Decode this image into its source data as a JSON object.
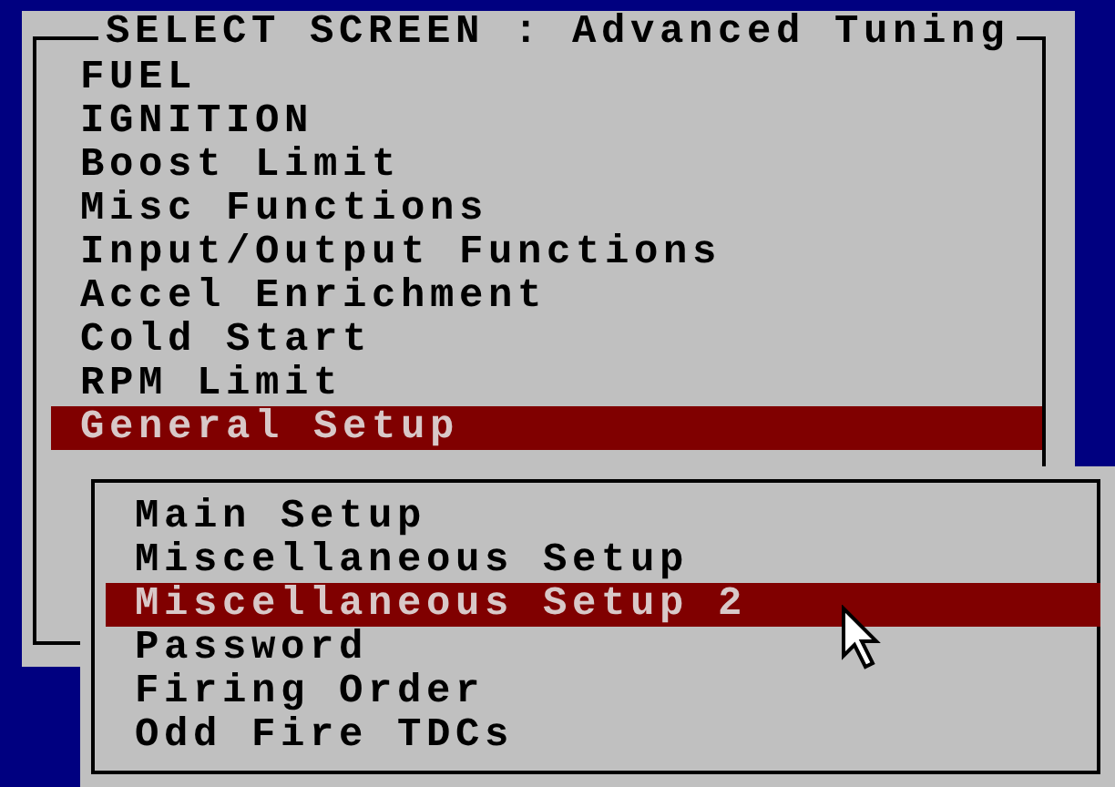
{
  "dialog": {
    "title": "SELECT SCREEN : Advanced Tuning",
    "items": [
      {
        "label": "FUEL",
        "selected": false
      },
      {
        "label": "IGNITION",
        "selected": false
      },
      {
        "label": "Boost Limit",
        "selected": false
      },
      {
        "label": "Misc Functions",
        "selected": false
      },
      {
        "label": "Input/Output Functions",
        "selected": false
      },
      {
        "label": "Accel Enrichment",
        "selected": false
      },
      {
        "label": "Cold Start",
        "selected": false
      },
      {
        "label": "RPM Limit",
        "selected": false
      },
      {
        "label": "General Setup",
        "selected": true
      }
    ]
  },
  "submenu": {
    "items": [
      {
        "label": "Main Setup",
        "selected": false
      },
      {
        "label": "Miscellaneous Setup",
        "selected": false
      },
      {
        "label": "Miscellaneous Setup 2",
        "selected": true
      },
      {
        "label": "Password",
        "selected": false
      },
      {
        "label": "Firing Order",
        "selected": false
      },
      {
        "label": "Odd Fire TDCs",
        "selected": false
      }
    ]
  }
}
